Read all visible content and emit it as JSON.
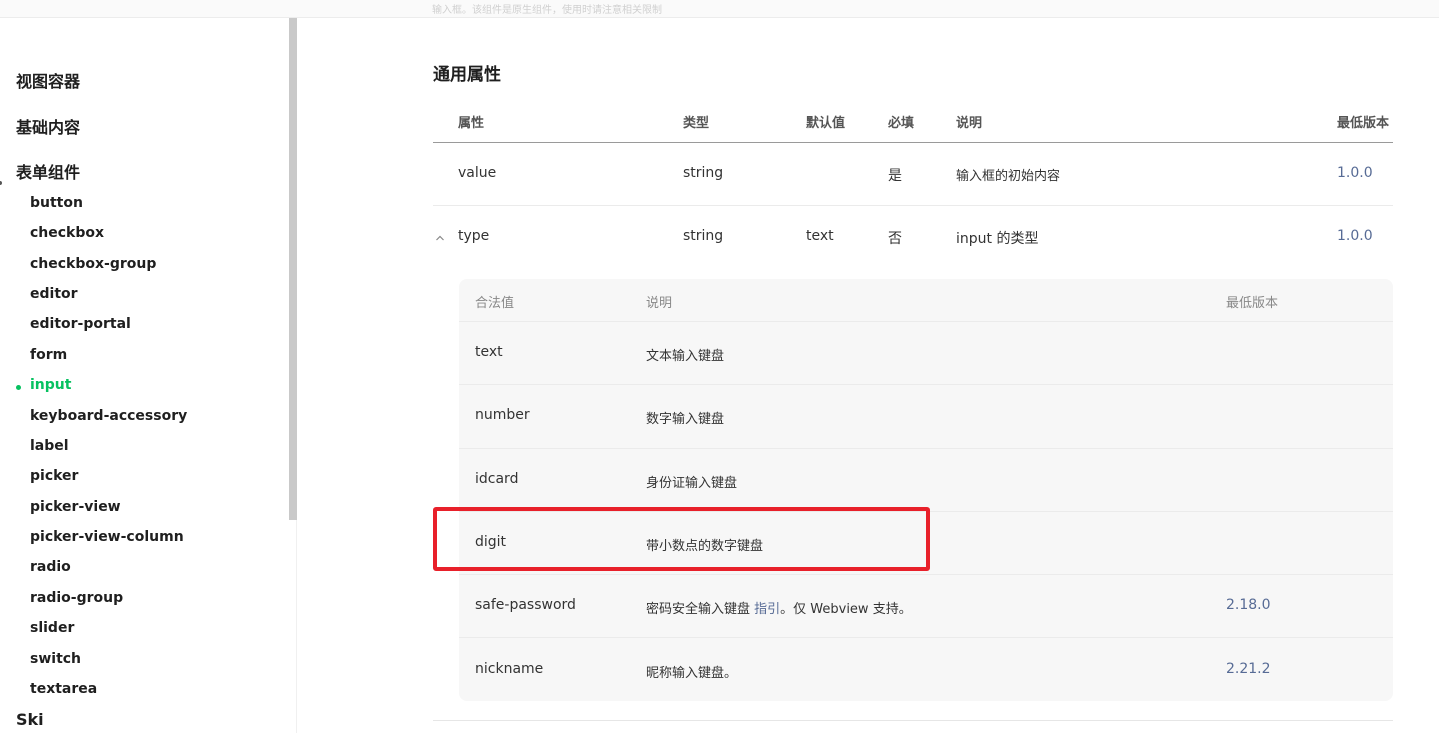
{
  "topbar": {
    "text": "输入框。该组件是原生组件，使用时请注意相关限制"
  },
  "sidebar": {
    "categories": [
      "视图容器",
      "基础内容",
      "表单组件"
    ],
    "items": [
      "button",
      "checkbox",
      "checkbox-group",
      "editor",
      "editor-portal",
      "form",
      "input",
      "keyboard-accessory",
      "label",
      "picker",
      "picker-view",
      "picker-view-column",
      "radio",
      "radio-group",
      "slider",
      "switch",
      "textarea"
    ],
    "active_item": "input",
    "next_category_partial": "Ski"
  },
  "main": {
    "section_title": "通用属性",
    "columns": [
      "属性",
      "类型",
      "默认值",
      "必填",
      "说明",
      "最低版本"
    ],
    "rows": [
      {
        "attr": "value",
        "type": "string",
        "default": "",
        "required": "是",
        "desc": "输入框的初始内容",
        "version": "1.0.0"
      },
      {
        "attr": "type",
        "type": "string",
        "default": "text",
        "required": "否",
        "desc": "input 的类型",
        "version": "1.0.0"
      }
    ],
    "subtable": {
      "columns": [
        "合法值",
        "说明",
        "最低版本"
      ],
      "rows": [
        {
          "value": "text",
          "desc": "文本输入键盘",
          "version": ""
        },
        {
          "value": "number",
          "desc": "数字输入键盘",
          "version": ""
        },
        {
          "value": "idcard",
          "desc": "身份证输入键盘",
          "version": ""
        },
        {
          "value": "digit",
          "desc": "带小数点的数字键盘",
          "version": ""
        },
        {
          "value": "safe-password",
          "desc_prefix": "密码安全输入键盘 ",
          "desc_link": "指引",
          "desc_suffix": "。仅 Webview 支持。",
          "version": "2.18.0"
        },
        {
          "value": "nickname",
          "desc": "昵称输入键盘。",
          "version": "2.21.2"
        }
      ]
    }
  },
  "colors": {
    "accent": "#07c160",
    "link": "#576b95",
    "highlight": "#e8202a"
  }
}
